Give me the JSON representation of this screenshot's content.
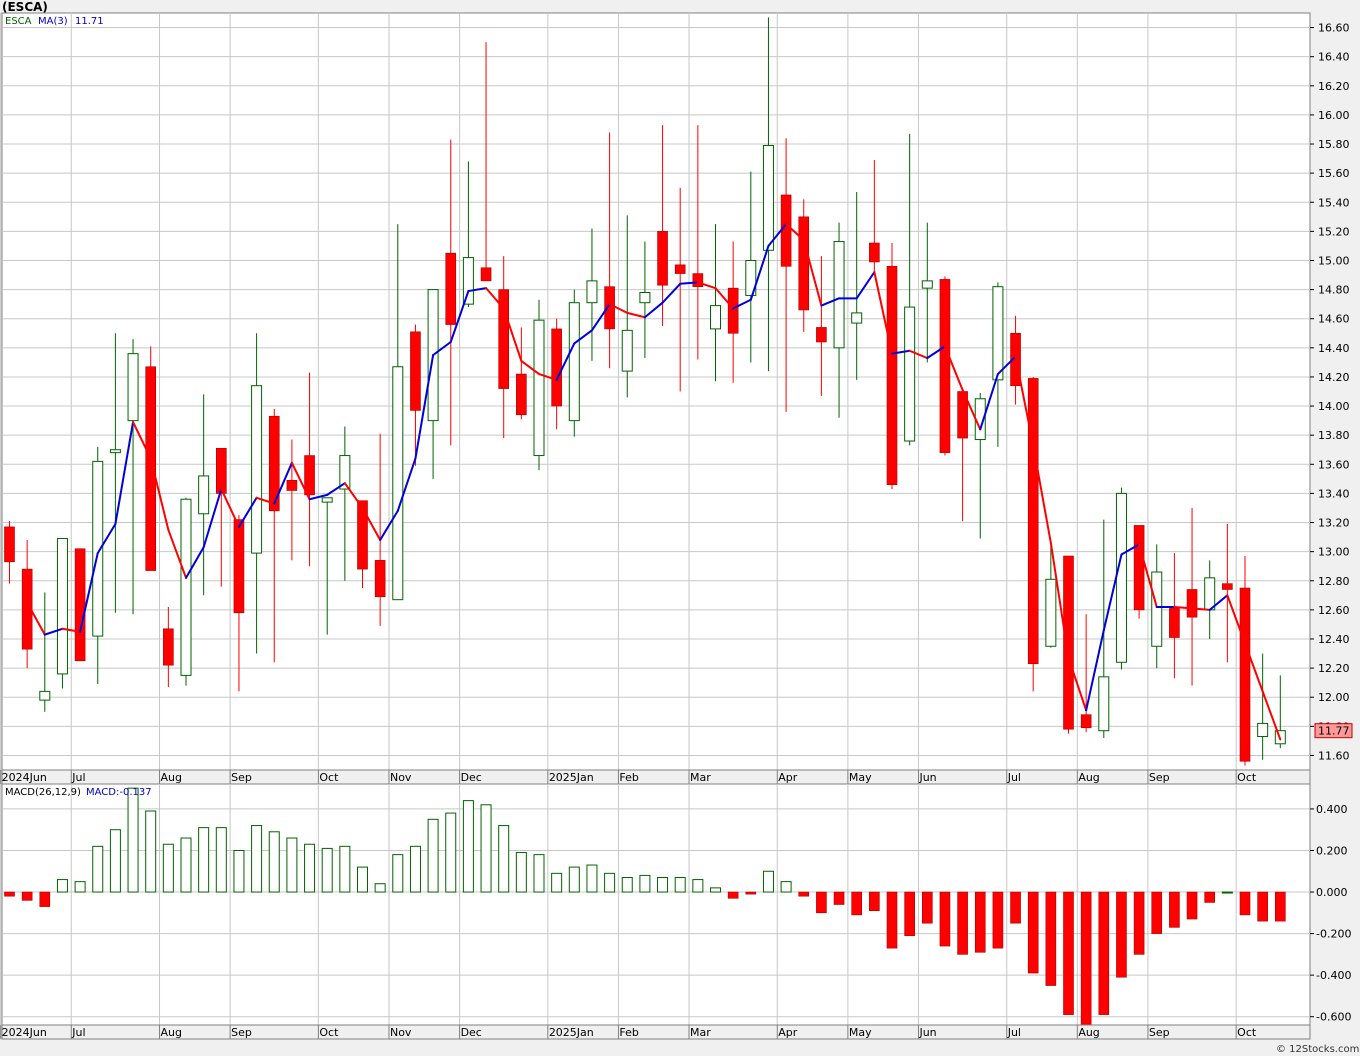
{
  "title": "(ESCA)",
  "watermark": "© 12Stocks.com",
  "legend": {
    "symbol": "ESCA",
    "ma_label": "MA(3)",
    "ma_value": "11.71",
    "macd_label": "MACD(26,12,9)",
    "macd_value_label": "MACD:-0.137"
  },
  "last_price_label": "11.77",
  "colors": {
    "up": "#006400",
    "down": "#ff0000",
    "ma_up": "#0000dd",
    "ma_down": "#ff0000",
    "grid": "#c8c8c8",
    "price_tag": "#ff9999"
  },
  "chart_data": [
    {
      "type": "candlestick",
      "interval": "weekly",
      "price_axis": {
        "min": 11.5,
        "max": 16.7,
        "ticks": [
          "11.60",
          "11.80",
          "12.00",
          "12.20",
          "12.40",
          "12.60",
          "12.80",
          "13.00",
          "13.20",
          "13.40",
          "13.60",
          "13.80",
          "14.00",
          "14.20",
          "14.40",
          "14.60",
          "14.80",
          "15.00",
          "15.20",
          "15.40",
          "15.60",
          "15.80",
          "16.00",
          "16.20",
          "16.40",
          "16.60"
        ]
      },
      "time_axis": [
        {
          "label": "2024Jun",
          "index": 0
        },
        {
          "label": "Jul",
          "index": 4
        },
        {
          "label": "Aug",
          "index": 9
        },
        {
          "label": "Sep",
          "index": 13
        },
        {
          "label": "Oct",
          "index": 18
        },
        {
          "label": "Nov",
          "index": 22
        },
        {
          "label": "Dec",
          "index": 26
        },
        {
          "label": "2025Jan",
          "index": 31
        },
        {
          "label": "Feb",
          "index": 35
        },
        {
          "label": "Mar",
          "index": 39
        },
        {
          "label": "Apr",
          "index": 44
        },
        {
          "label": "May",
          "index": 48
        },
        {
          "label": "Jun",
          "index": 52
        },
        {
          "label": "Jul",
          "index": 57
        },
        {
          "label": "Aug",
          "index": 61
        },
        {
          "label": "Sep",
          "index": 65
        },
        {
          "label": "Oct",
          "index": 70
        }
      ],
      "candles": [
        {
          "o": 13.17,
          "h": 13.21,
          "l": 12.78,
          "c": 12.93
        },
        {
          "o": 12.88,
          "h": 13.08,
          "l": 12.2,
          "c": 12.33
        },
        {
          "o": 11.98,
          "h": 12.72,
          "l": 11.9,
          "c": 12.04
        },
        {
          "o": 12.16,
          "h": 13.09,
          "l": 12.06,
          "c": 13.09
        },
        {
          "o": 13.02,
          "h": 13.02,
          "l": 12.27,
          "c": 12.25
        },
        {
          "o": 12.42,
          "h": 13.72,
          "l": 12.09,
          "c": 13.62
        },
        {
          "o": 13.68,
          "h": 14.5,
          "l": 12.58,
          "c": 13.7
        },
        {
          "o": 13.9,
          "h": 14.46,
          "l": 12.57,
          "c": 14.36
        },
        {
          "o": 14.27,
          "h": 14.41,
          "l": 12.88,
          "c": 12.87
        },
        {
          "o": 12.47,
          "h": 12.62,
          "l": 12.07,
          "c": 12.22
        },
        {
          "o": 12.15,
          "h": 13.37,
          "l": 12.08,
          "c": 13.36
        },
        {
          "o": 13.26,
          "h": 14.08,
          "l": 12.7,
          "c": 13.52
        },
        {
          "o": 13.71,
          "h": 13.71,
          "l": 12.76,
          "c": 13.4
        },
        {
          "o": 13.22,
          "h": 13.25,
          "l": 12.04,
          "c": 12.58
        },
        {
          "o": 12.99,
          "h": 14.5,
          "l": 12.3,
          "c": 14.14
        },
        {
          "o": 13.93,
          "h": 13.98,
          "l": 12.24,
          "c": 13.28
        },
        {
          "o": 13.49,
          "h": 13.77,
          "l": 12.94,
          "c": 13.42
        },
        {
          "o": 13.66,
          "h": 14.23,
          "l": 12.9,
          "c": 13.39
        },
        {
          "o": 13.34,
          "h": 13.36,
          "l": 12.43,
          "c": 13.37
        },
        {
          "o": 13.43,
          "h": 13.86,
          "l": 12.8,
          "c": 13.66
        },
        {
          "o": 13.35,
          "h": 13.35,
          "l": 12.75,
          "c": 12.88
        },
        {
          "o": 12.94,
          "h": 13.81,
          "l": 12.49,
          "c": 12.69
        },
        {
          "o": 12.67,
          "h": 15.25,
          "l": 12.67,
          "c": 14.27
        },
        {
          "o": 14.51,
          "h": 14.56,
          "l": 13.59,
          "c": 13.97
        },
        {
          "o": 13.9,
          "h": 14.8,
          "l": 13.5,
          "c": 14.8
        },
        {
          "o": 15.05,
          "h": 15.83,
          "l": 13.73,
          "c": 14.56
        },
        {
          "o": 14.7,
          "h": 15.68,
          "l": 14.68,
          "c": 15.02
        },
        {
          "o": 14.95,
          "h": 16.5,
          "l": 14.87,
          "c": 14.86
        },
        {
          "o": 14.8,
          "h": 15.03,
          "l": 13.78,
          "c": 14.12
        },
        {
          "o": 14.22,
          "h": 14.54,
          "l": 13.91,
          "c": 13.94
        },
        {
          "o": 13.66,
          "h": 14.73,
          "l": 13.56,
          "c": 14.59
        },
        {
          "o": 14.53,
          "h": 14.6,
          "l": 13.84,
          "c": 14.0
        },
        {
          "o": 13.9,
          "h": 14.8,
          "l": 13.79,
          "c": 14.71
        },
        {
          "o": 14.71,
          "h": 15.22,
          "l": 14.31,
          "c": 14.86
        },
        {
          "o": 14.82,
          "h": 15.88,
          "l": 14.26,
          "c": 14.53
        },
        {
          "o": 14.24,
          "h": 15.31,
          "l": 14.06,
          "c": 14.52
        },
        {
          "o": 14.71,
          "h": 15.13,
          "l": 14.33,
          "c": 14.78
        },
        {
          "o": 15.2,
          "h": 15.93,
          "l": 14.55,
          "c": 14.83
        },
        {
          "o": 14.97,
          "h": 15.5,
          "l": 14.1,
          "c": 14.91
        },
        {
          "o": 14.91,
          "h": 15.93,
          "l": 14.32,
          "c": 14.82
        },
        {
          "o": 14.53,
          "h": 15.25,
          "l": 14.17,
          "c": 14.69
        },
        {
          "o": 14.81,
          "h": 15.13,
          "l": 14.16,
          "c": 14.5
        },
        {
          "o": 14.76,
          "h": 15.61,
          "l": 14.3,
          "c": 15.0
        },
        {
          "o": 15.07,
          "h": 16.67,
          "l": 14.24,
          "c": 15.79
        },
        {
          "o": 15.45,
          "h": 15.84,
          "l": 13.96,
          "c": 14.96
        },
        {
          "o": 15.3,
          "h": 15.42,
          "l": 14.51,
          "c": 14.66
        },
        {
          "o": 14.54,
          "h": 15.03,
          "l": 14.07,
          "c": 14.44
        },
        {
          "o": 14.4,
          "h": 15.26,
          "l": 13.92,
          "c": 15.13
        },
        {
          "o": 14.57,
          "h": 15.47,
          "l": 14.18,
          "c": 14.64
        },
        {
          "o": 15.12,
          "h": 15.69,
          "l": 14.91,
          "c": 14.99
        },
        {
          "o": 14.96,
          "h": 15.12,
          "l": 13.43,
          "c": 13.46
        },
        {
          "o": 13.76,
          "h": 15.87,
          "l": 13.73,
          "c": 14.68
        },
        {
          "o": 14.81,
          "h": 15.26,
          "l": 14.3,
          "c": 14.86
        },
        {
          "o": 14.87,
          "h": 14.89,
          "l": 13.66,
          "c": 13.68
        },
        {
          "o": 14.1,
          "h": 14.1,
          "l": 13.21,
          "c": 13.78
        },
        {
          "o": 13.77,
          "h": 14.09,
          "l": 13.09,
          "c": 14.05
        },
        {
          "o": 14.18,
          "h": 14.85,
          "l": 13.72,
          "c": 14.82
        },
        {
          "o": 14.5,
          "h": 14.62,
          "l": 14.01,
          "c": 14.14
        },
        {
          "o": 14.19,
          "h": 14.2,
          "l": 12.04,
          "c": 12.23
        },
        {
          "o": 12.35,
          "h": 13.04,
          "l": 12.34,
          "c": 12.81
        },
        {
          "o": 12.97,
          "h": 12.97,
          "l": 11.75,
          "c": 11.78
        },
        {
          "o": 11.88,
          "h": 12.57,
          "l": 11.76,
          "c": 11.79
        },
        {
          "o": 11.77,
          "h": 13.22,
          "l": 11.72,
          "c": 12.14
        },
        {
          "o": 12.24,
          "h": 13.44,
          "l": 12.19,
          "c": 13.4
        },
        {
          "o": 13.18,
          "h": 13.18,
          "l": 12.54,
          "c": 12.6
        },
        {
          "o": 12.35,
          "h": 13.05,
          "l": 12.2,
          "c": 12.86
        },
        {
          "o": 12.61,
          "h": 12.99,
          "l": 12.13,
          "c": 12.41
        },
        {
          "o": 12.74,
          "h": 13.3,
          "l": 12.08,
          "c": 12.55
        },
        {
          "o": 12.6,
          "h": 12.94,
          "l": 12.4,
          "c": 12.82
        },
        {
          "o": 12.78,
          "h": 13.19,
          "l": 12.24,
          "c": 12.74
        },
        {
          "o": 12.75,
          "h": 12.97,
          "l": 11.53,
          "c": 11.56
        },
        {
          "o": 11.73,
          "h": 12.3,
          "l": 11.57,
          "c": 11.82
        },
        {
          "o": 11.68,
          "h": 12.15,
          "l": 11.65,
          "c": 11.77
        }
      ],
      "ma3": [
        null,
        12.65,
        12.43,
        12.47,
        12.45,
        12.99,
        13.19,
        13.89,
        13.64,
        13.15,
        12.82,
        13.03,
        13.43,
        13.17,
        13.37,
        13.33,
        13.61,
        13.36,
        13.39,
        13.47,
        13.3,
        13.08,
        13.28,
        13.64,
        14.35,
        14.44,
        14.79,
        14.81,
        14.67,
        14.31,
        14.22,
        14.18,
        14.43,
        14.52,
        14.7,
        14.64,
        14.61,
        14.71,
        14.84,
        14.85,
        14.81,
        14.67,
        14.73,
        15.1,
        15.25,
        15.14,
        14.69,
        14.74,
        14.74,
        14.92,
        14.36,
        14.38,
        14.33,
        14.41,
        14.11,
        13.84,
        14.22,
        14.34,
        13.73,
        13.06,
        12.27,
        11.91,
        12.46,
        12.98,
        13.05,
        12.62,
        12.62,
        12.61,
        12.6,
        12.7,
        12.37,
        12.04,
        11.71
      ],
      "macd": {
        "min": -0.64,
        "max": 0.52,
        "ticks": [
          "-0.600",
          "-0.400",
          "-0.200",
          "0.000",
          "0.200",
          "0.400"
        ],
        "values": [
          -0.02,
          -0.04,
          -0.07,
          0.06,
          0.05,
          0.22,
          0.3,
          0.5,
          0.39,
          0.23,
          0.26,
          0.31,
          0.31,
          0.2,
          0.32,
          0.29,
          0.26,
          0.23,
          0.21,
          0.22,
          0.12,
          0.04,
          0.18,
          0.22,
          0.35,
          0.38,
          0.44,
          0.42,
          0.32,
          0.19,
          0.18,
          0.09,
          0.12,
          0.13,
          0.09,
          0.07,
          0.08,
          0.07,
          0.07,
          0.06,
          0.02,
          -0.03,
          -0.01,
          0.1,
          0.05,
          -0.02,
          -0.1,
          -0.06,
          -0.11,
          -0.09,
          -0.27,
          -0.21,
          -0.15,
          -0.26,
          -0.3,
          -0.29,
          -0.27,
          -0.15,
          -0.39,
          -0.45,
          -0.59,
          -0.64,
          -0.59,
          -0.41,
          -0.3,
          -0.2,
          -0.17,
          -0.13,
          -0.05,
          0.0,
          -0.11,
          -0.14,
          -0.14
        ]
      }
    }
  ]
}
